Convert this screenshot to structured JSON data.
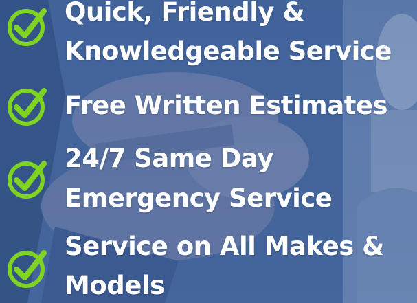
{
  "colors": {
    "background": "#3f5f94",
    "check": "#7fd321",
    "text": "#ffffff"
  },
  "items": [
    {
      "lines": [
        "Quick, Friendly &",
        "Knowledgeable Service"
      ],
      "icon": "check-circle-icon"
    },
    {
      "lines": [
        "Free Written Estimates"
      ],
      "icon": "check-circle-icon"
    },
    {
      "lines": [
        "24/7 Same Day",
        "Emergency Service"
      ],
      "icon": "check-circle-icon"
    },
    {
      "lines": [
        "Service on All Makes &",
        "Models"
      ],
      "icon": "check-circle-icon"
    }
  ]
}
